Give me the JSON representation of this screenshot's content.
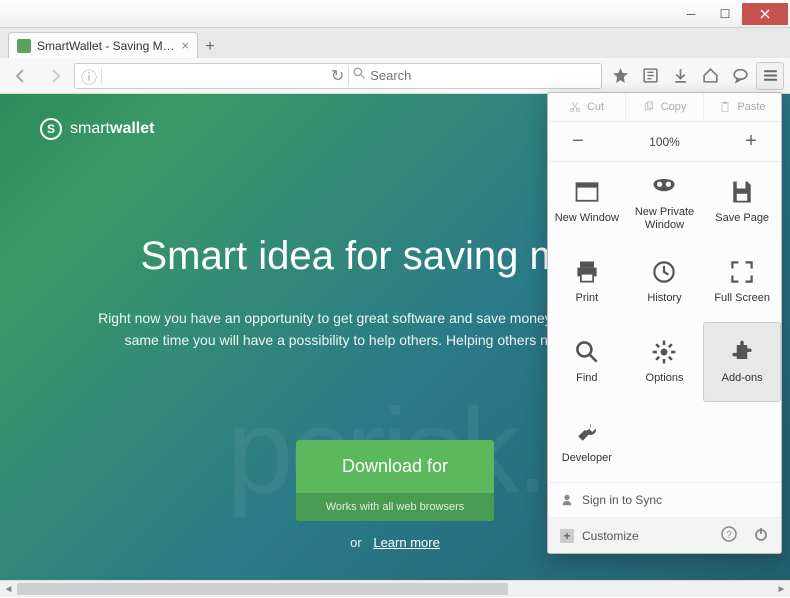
{
  "window": {
    "tab_title": "SmartWallet - Saving Mon..."
  },
  "navbar": {
    "search_placeholder": "Search"
  },
  "brand": {
    "logo_letter": "S",
    "name_light": "smart",
    "name_bold": "wallet"
  },
  "hero": {
    "headline": "Smart idea for saving money",
    "body": "Right now you have an opportunity to get great software and save money while shopping. At the same time you will have a possibility to help others. Helping others never were so easy!"
  },
  "cta": {
    "button": "Download for",
    "sub": "Works with all web browsers",
    "or": "or",
    "learn": "Learn more"
  },
  "menu": {
    "cut": "Cut",
    "copy": "Copy",
    "paste": "Paste",
    "zoom": "100%",
    "items": [
      "New Window",
      "New Private Window",
      "Save Page",
      "Print",
      "History",
      "Full Screen",
      "Find",
      "Options",
      "Add-ons",
      "Developer"
    ],
    "signin": "Sign in to Sync",
    "customize": "Customize"
  },
  "watermark": "pcrisk.com"
}
